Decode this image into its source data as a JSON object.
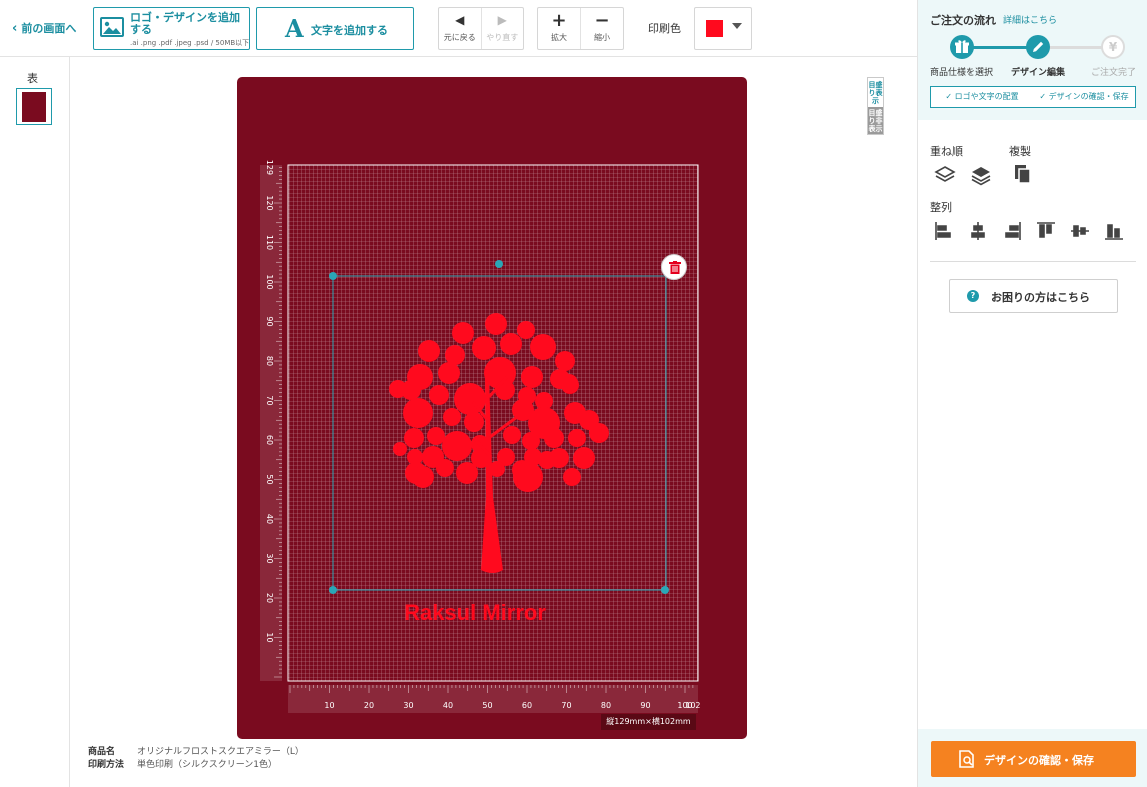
{
  "toolbar": {
    "back_label": "前の画面へ",
    "add_logo_label": "ロゴ・デザインを追加する",
    "add_logo_sub": ".ai .png .pdf .jpeg .psd / 50MB以下",
    "add_text_label": "文字を追加する",
    "add_text_glyph": "A",
    "undo_label": "元に戻る",
    "redo_label": "やり直す",
    "zoom_in_label": "拡大",
    "zoom_out_label": "縮小",
    "print_color_label": "印刷色",
    "print_color_value": "#ff0a1e"
  },
  "side": {
    "face_label": "表"
  },
  "canvas": {
    "mirror_color": "#7a0b1f",
    "ruler_toggle_on": "目盛り表示",
    "ruler_toggle_off": "目盛り非表示",
    "size_label": "縦129mm×横102mm",
    "design_text": "Raksul Mirror",
    "design_color": "#ff0a1e",
    "v_ruler_labels": [
      "10",
      "20",
      "30",
      "40",
      "50",
      "60",
      "70",
      "80",
      "90",
      "100",
      "110",
      "120",
      "129"
    ],
    "h_ruler_labels": [
      "10",
      "20",
      "30",
      "40",
      "50",
      "60",
      "70",
      "80",
      "90",
      "100",
      "102"
    ]
  },
  "product": {
    "name_key": "商品名",
    "name_value": "オリジナルフロストスクエアミラー（L）",
    "method_key": "印刷方法",
    "method_value": "単色印刷（シルクスクリーン1色）"
  },
  "panel": {
    "flow_title": "ご注文の流れ",
    "flow_detail_link": "詳細はこちら",
    "steps": [
      {
        "label": "商品仕様を選択",
        "icon": "gift-icon"
      },
      {
        "label": "デザイン編集",
        "icon": "pencil-icon"
      },
      {
        "label": "ご注文完了",
        "icon": "yen-icon"
      }
    ],
    "sub_steps": [
      "✓ ロゴや文字の配置",
      "✓ デザインの確認・保存"
    ],
    "order_label": "重ね順",
    "duplicate_label": "複製",
    "align_label": "整列",
    "help_label": "お困りの方はこちら",
    "save_label": "デザインの確認・保存",
    "accent_color": "#1f9aab",
    "save_color": "#f58220"
  }
}
